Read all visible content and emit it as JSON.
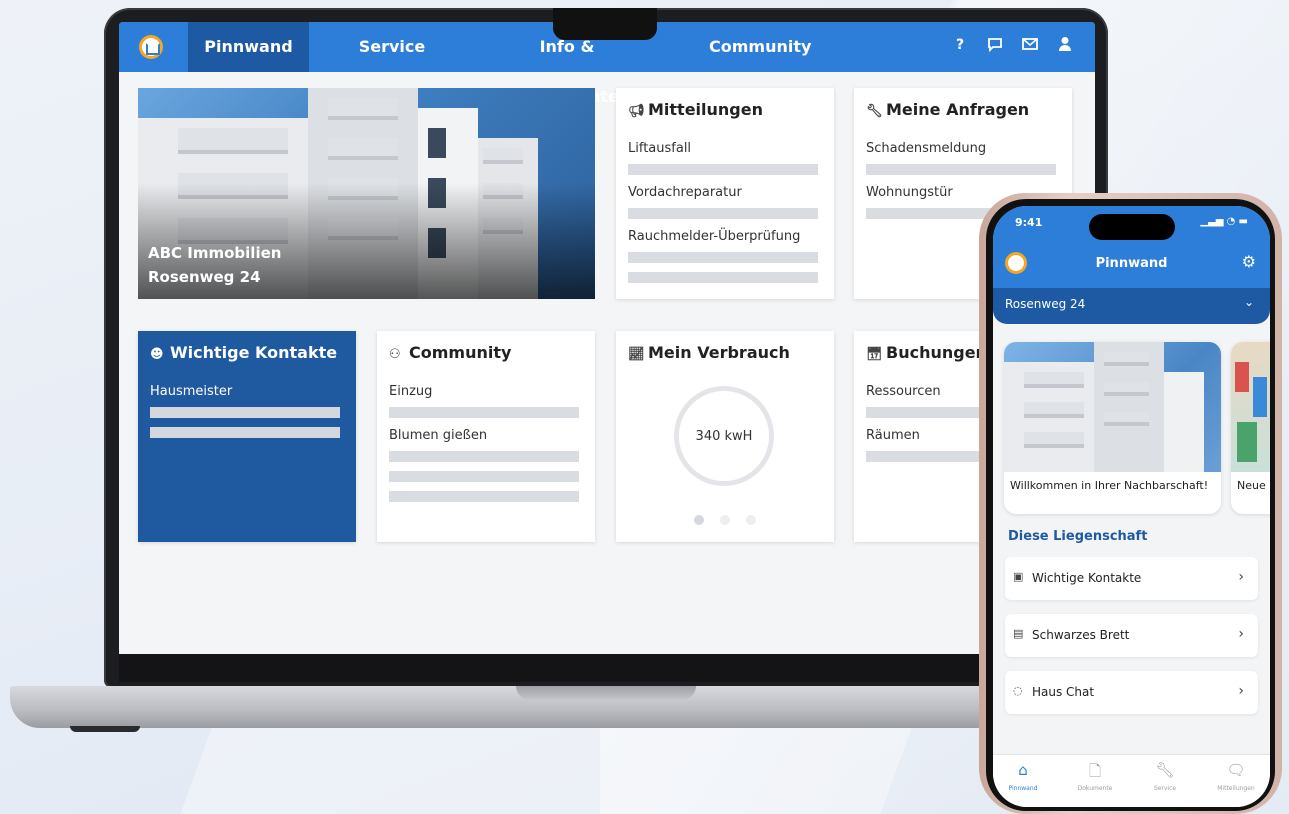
{
  "desktop": {
    "nav": {
      "items": [
        "Pinnwand",
        "Service",
        "Info & Dokumente",
        "Community"
      ],
      "active": "Pinnwand",
      "icons": [
        "help-icon",
        "chat-icon",
        "mail-icon",
        "user-icon"
      ],
      "help_glyph": "?"
    },
    "hero": {
      "line1": "ABC Immobilien",
      "line2": "Rosenweg 24"
    },
    "cards": {
      "mitteilungen": {
        "title": "Mitteilungen",
        "items": [
          "Liftausfall",
          "Vordachreparatur",
          "Rauchmelder-Überprüfung"
        ]
      },
      "anfragen": {
        "title": "Meine Anfragen",
        "items": [
          "Schadensmeldung",
          "Wohnungstür"
        ]
      },
      "kontakte": {
        "title": "Wichtige Kontakte",
        "items": [
          "Hausmeister"
        ]
      },
      "community": {
        "title": "Community",
        "items": [
          "Einzug",
          "Blumen gießen"
        ]
      },
      "verbrauch": {
        "title": "Mein Verbrauch",
        "value": "340 kwH"
      },
      "buchungen": {
        "title": "Buchungen",
        "items": [
          "Ressourcen",
          "Räumen"
        ]
      }
    }
  },
  "mobile": {
    "status_time": "9:41",
    "title": "Pinnwand",
    "location": "Rosenweg 24",
    "cards": [
      "Willkommen in Ihrer Nachbarschaft!",
      "Neue"
    ],
    "section_title": "Diese Liegenschaft",
    "rows": [
      "Wichtige Kontakte",
      "Schwarzes Brett",
      "Haus Chat"
    ],
    "tabs": [
      "Pinnwand",
      "Dokumente",
      "Service",
      "Mitteilungen"
    ],
    "colors": {
      "primary": "#2d7ed8",
      "dark": "#1d5aa3",
      "logo_ring": "#f5a623"
    }
  }
}
